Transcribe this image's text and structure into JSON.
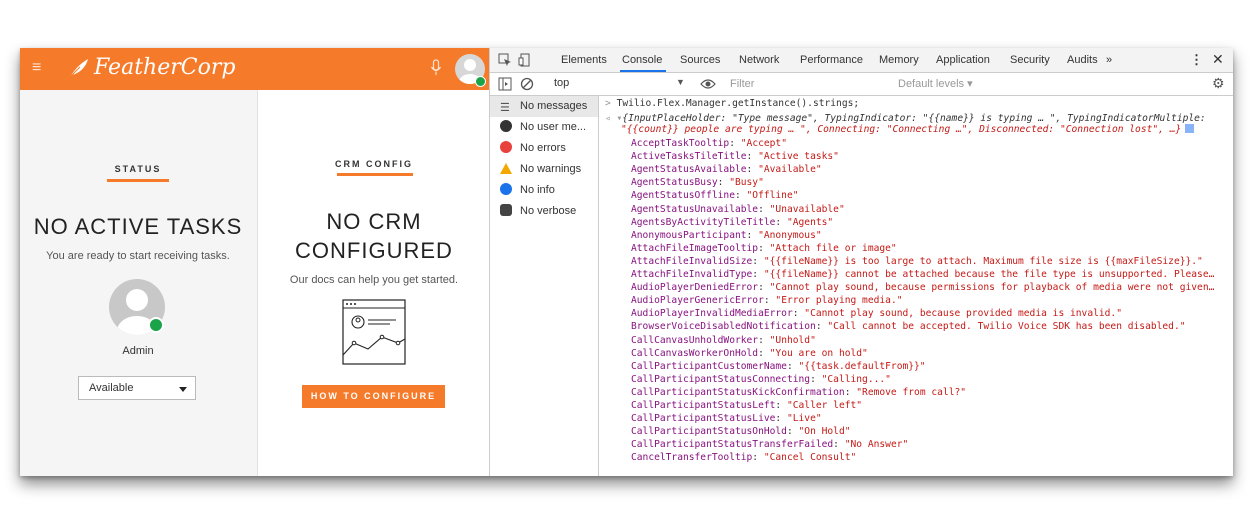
{
  "app": {
    "logo_text": "FeatherCorp",
    "accent_color": "#f57b2b",
    "status_dot_color": "#1ba34a"
  },
  "status_panel": {
    "title": "STATUS",
    "heading": "NO ACTIVE TASKS",
    "subtext": "You are ready to start receiving tasks.",
    "user_name": "Admin",
    "activity_value": "Available"
  },
  "crm_panel": {
    "title": "CRM CONFIG",
    "heading_line1": "NO CRM",
    "heading_line2": "CONFIGURED",
    "subtext": "Our docs can help you get started.",
    "button_label": "HOW TO CONFIGURE"
  },
  "devtools": {
    "tabs": [
      "Elements",
      "Console",
      "Sources",
      "Network",
      "Performance",
      "Memory",
      "Application",
      "Security",
      "Audits",
      "»"
    ],
    "active_tab": "Console",
    "context": "top",
    "filter_placeholder": "Filter",
    "levels_label": "Default levels ▾",
    "sidebar": [
      {
        "label": "No messages",
        "icon": "list-icon"
      },
      {
        "label": "No user me...",
        "icon": "user-icon"
      },
      {
        "label": "No errors",
        "icon": "error-icon"
      },
      {
        "label": "No warnings",
        "icon": "warning-icon"
      },
      {
        "label": "No info",
        "icon": "info-icon"
      },
      {
        "label": "No verbose",
        "icon": "bug-icon"
      }
    ],
    "command": "Twilio.Flex.Manager.getInstance().strings;",
    "summary_line1": "{InputPlaceHolder: \"Type message\", TypingIndicator: \"{{name}} is typing … \", TypingIndicatorMultiple:",
    "summary_line2": "\"{{count}} people are typing … \", Connecting: \"Connecting …\", Disconnected: \"Connection lost\", …}",
    "entries": [
      {
        "key": "AcceptTaskTooltip",
        "value": "\"Accept\""
      },
      {
        "key": "ActiveTasksTileTitle",
        "value": "\"Active tasks\""
      },
      {
        "key": "AgentStatusAvailable",
        "value": "\"Available\""
      },
      {
        "key": "AgentStatusBusy",
        "value": "\"Busy\""
      },
      {
        "key": "AgentStatusOffline",
        "value": "\"Offline\""
      },
      {
        "key": "AgentStatusUnavailable",
        "value": "\"Unavailable\""
      },
      {
        "key": "AgentsByActivityTileTitle",
        "value": "\"Agents\""
      },
      {
        "key": "AnonymousParticipant",
        "value": "\"Anonymous\""
      },
      {
        "key": "AttachFileImageTooltip",
        "value": "\"Attach file or image\""
      },
      {
        "key": "AttachFileInvalidSize",
        "value": "\"{{fileName}} is too large to attach. Maximum file size is {{maxFileSize}}.\""
      },
      {
        "key": "AttachFileInvalidType",
        "value": "\"{{fileName}} cannot be attached because the file type is unsupported. Please…"
      },
      {
        "key": "AudioPlayerDeniedError",
        "value": "\"Cannot play sound, because permissions for playback of media were not given…"
      },
      {
        "key": "AudioPlayerGenericError",
        "value": "\"Error playing media.\""
      },
      {
        "key": "AudioPlayerInvalidMediaError",
        "value": "\"Cannot play sound, because provided media is invalid.\""
      },
      {
        "key": "BrowserVoiceDisabledNotification",
        "value": "\"Call cannot be accepted. Twilio Voice SDK has been disabled.\""
      },
      {
        "key": "CallCanvasUnholdWorker",
        "value": "\"Unhold\""
      },
      {
        "key": "CallCanvasWorkerOnHold",
        "value": "\"You are on hold\""
      },
      {
        "key": "CallParticipantCustomerName",
        "value": "\"{{task.defaultFrom}}\""
      },
      {
        "key": "CallParticipantStatusConnecting",
        "value": "\"Calling...\""
      },
      {
        "key": "CallParticipantStatusKickConfirmation",
        "value": "\"Remove from call?\""
      },
      {
        "key": "CallParticipantStatusLeft",
        "value": "\"Caller left\""
      },
      {
        "key": "CallParticipantStatusLive",
        "value": "\"Live\""
      },
      {
        "key": "CallParticipantStatusOnHold",
        "value": "\"On Hold\""
      },
      {
        "key": "CallParticipantStatusTransferFailed",
        "value": "\"No Answer\""
      },
      {
        "key": "CancelTransferTooltip",
        "value": "\"Cancel Consult\""
      }
    ]
  }
}
